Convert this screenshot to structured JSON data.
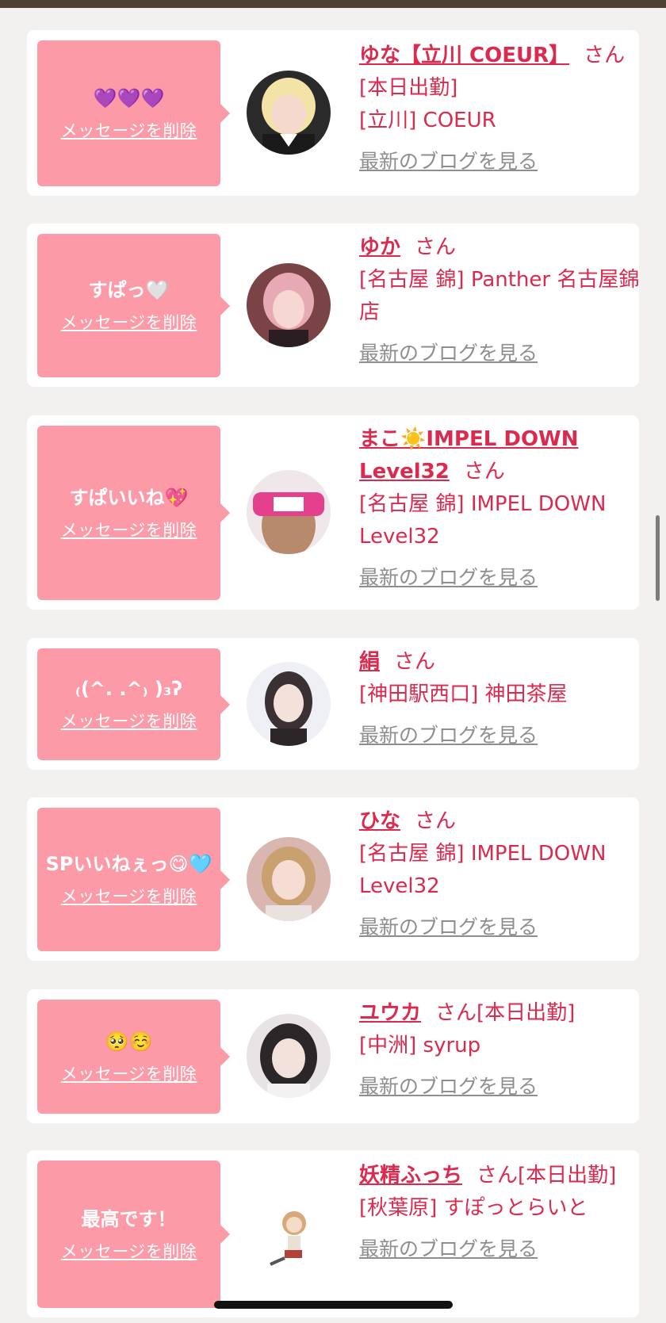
{
  "delete_label": "メッセージを削除",
  "san_label": "さん",
  "blog_label": "最新のブログを見る",
  "entries": [
    {
      "message": "💜💜💜",
      "name": "ゆな【立川 COEUR】",
      "status": "[本日出勤]",
      "shop": "[立川] COEUR"
    },
    {
      "message": "すぱっ🤍",
      "name": "ゆか",
      "status": "",
      "shop": "[名古屋 錦] Panther 名古屋錦店"
    },
    {
      "message": "すぱいいね💖",
      "name": "まこ☀️IMPEL DOWN Level32",
      "status": "",
      "shop": "[名古屋 錦] IMPEL DOWN Level32"
    },
    {
      "message": "₍(^. .^₎ )₃ʔ",
      "name": "絹",
      "status": "",
      "shop": "[神田駅西口] 神田茶屋"
    },
    {
      "message": "SPいいねぇっ😋🩵",
      "name": "ひな",
      "status": "",
      "shop": "[名古屋 錦] IMPEL DOWN Level32"
    },
    {
      "message": "🥺☺️",
      "name": "ユウカ",
      "status": "[本日出勤]",
      "shop": "[中洲] syrup"
    },
    {
      "message": "最高です！",
      "name": "妖精ふっち",
      "status": "[本日出勤]",
      "shop": "[秋葉原] すぽっとらいと"
    }
  ],
  "colors": {
    "bubble": "#fc9aa7",
    "accent": "#db2a4e",
    "link_gray": "#8e8e8e",
    "background": "#f2f1f0"
  }
}
